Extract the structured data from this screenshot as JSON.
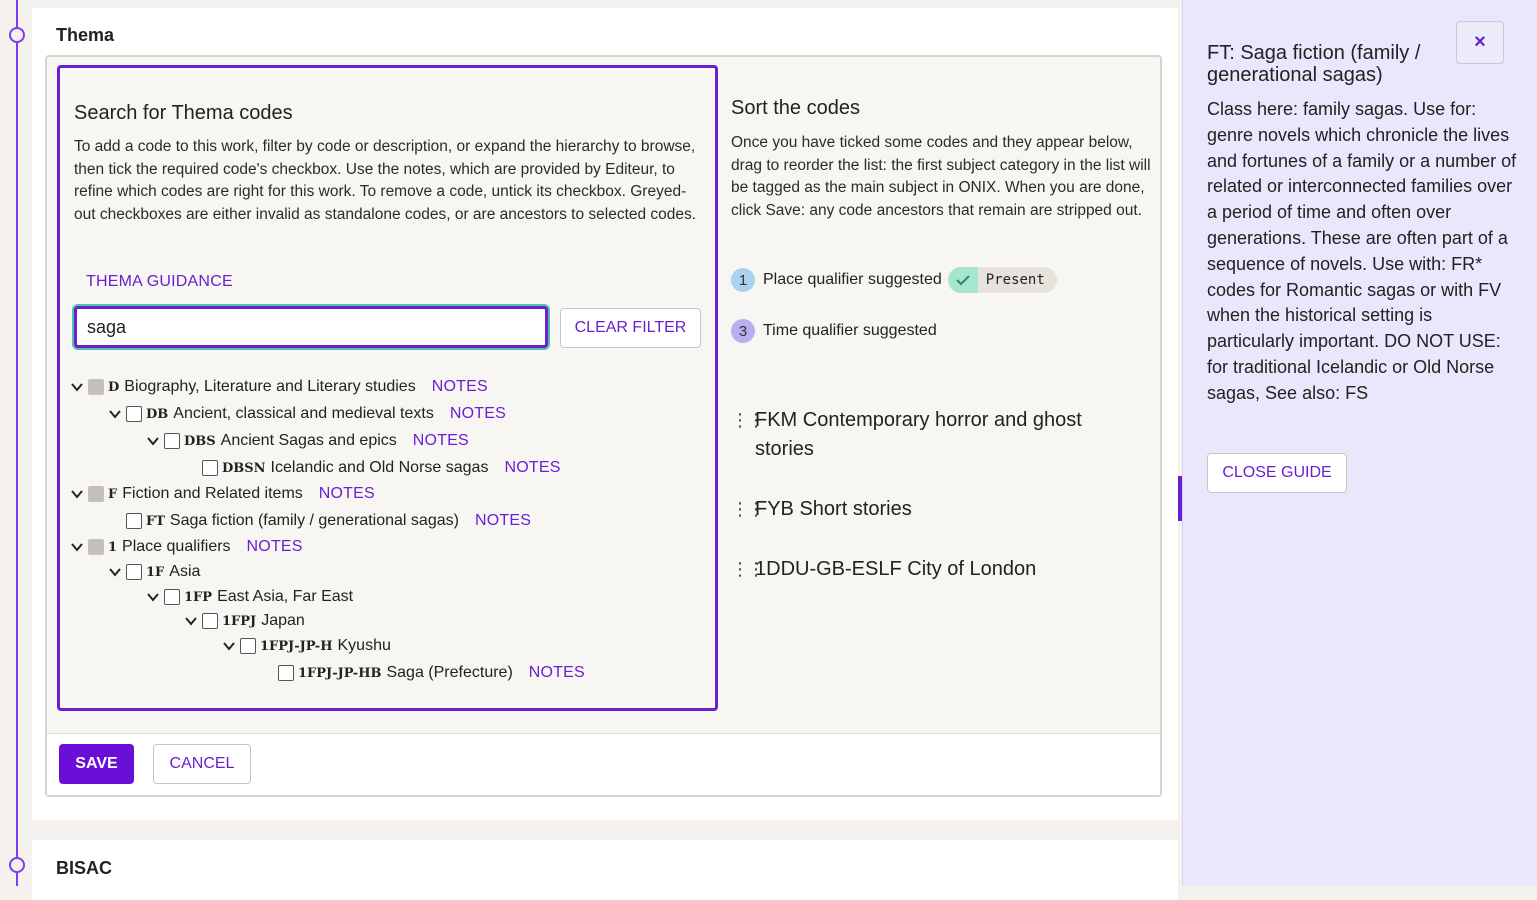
{
  "sections": {
    "thema_title": "Thema",
    "bisac_title": "BISAC"
  },
  "search": {
    "heading": "Search for Thema codes",
    "description": "To add a code to this work, filter by code or description, or expand the hierarchy to browse, then tick the required code's checkbox. Use the notes, which are provided by Editeur, to refine which codes are right for this work. To remove a code, untick its checkbox. Greyed-out checkboxes are either invalid as standalone codes, or are ancestors to selected codes.",
    "guidance_link": "THEMA GUIDANCE",
    "filter_value": "saga",
    "clear_filter": "CLEAR FILTER"
  },
  "tree": [
    {
      "code": "D",
      "desc": "Biography, Literature and Literary studies",
      "notes": "NOTES"
    },
    {
      "code": "DB",
      "desc": "Ancient, classical and medieval texts",
      "notes": "NOTES"
    },
    {
      "code": "DBS",
      "desc": "Ancient Sagas and epics",
      "notes": "NOTES"
    },
    {
      "code": "DBSN",
      "desc": "Icelandic and Old Norse sagas",
      "notes": "NOTES"
    },
    {
      "code": "F",
      "desc": "Fiction and Related items",
      "notes": "NOTES"
    },
    {
      "code": "FT",
      "desc": "Saga fiction (family / generational sagas)",
      "notes": "NOTES"
    },
    {
      "code": "1",
      "desc": "Place qualifiers",
      "notes": "NOTES"
    },
    {
      "code": "1F",
      "desc": "Asia",
      "notes": ""
    },
    {
      "code": "1FP",
      "desc": "East Asia, Far East",
      "notes": ""
    },
    {
      "code": "1FPJ",
      "desc": "Japan",
      "notes": ""
    },
    {
      "code": "1FPJ-JP-H",
      "desc": "Kyushu",
      "notes": ""
    },
    {
      "code": "1FPJ-JP-HB",
      "desc": "Saga (Prefecture)",
      "notes": "NOTES"
    }
  ],
  "sort": {
    "heading": "Sort the codes",
    "description": "Once you have ticked some codes and they appear below, drag to reorder the list: the first subject category in the list will be tagged as the main subject in ONIX. When you are done, click Save: any code ancestors that remain are stripped out.",
    "qualifiers": [
      {
        "number": "1",
        "label": "Place qualifier suggested",
        "status": "Present"
      },
      {
        "number": "3",
        "label": "Time qualifier suggested",
        "status": ""
      }
    ],
    "items": [
      "FKM Contemporary horror and ghost stories",
      "FYB Short stories",
      "1DDU-GB-ESLF City of London"
    ]
  },
  "actions": {
    "save": "SAVE",
    "cancel": "CANCEL"
  },
  "guide": {
    "title": "FT: Saga fiction (family / generational sagas)",
    "close_icon": "×",
    "body": "Class here: family sagas. Use for: genre novels which chronicle the lives and fortunes of a family or a number of related or interconnected families over a period of time and often over generations. These are often part of a sequence of novels. Use with: FR* codes for Romantic sagas or with FV when the historical setting is particularly important. DO NOT USE: for traditional Icelandic or Old Norse sagas, See also: FS",
    "close_button": "CLOSE GUIDE"
  },
  "colors": {
    "accent": "#6a1fd1",
    "guide_bg": "#e9e7fb",
    "badge_1": "#a9d3f0",
    "badge_3": "#b9aef0",
    "present_check": "#a6e6cf"
  }
}
